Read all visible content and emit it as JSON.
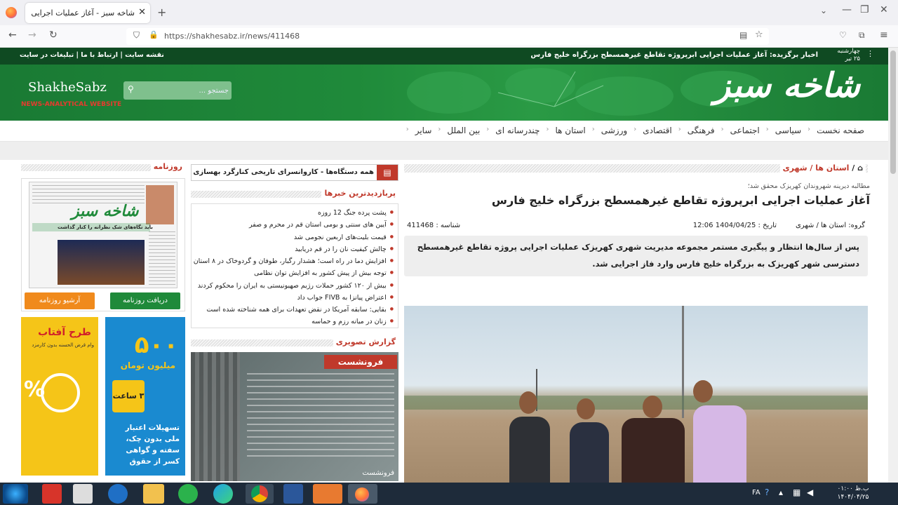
{
  "browser": {
    "tab_title": "شاخه سبز - آغاز عملیات اجرایی ابرپر",
    "url": "https://shakhesabz.ir/news/411468"
  },
  "site": {
    "date_day": "چهارشنبه",
    "date_num": "۲۵ تیر",
    "breaking_label": "اخبار برگزیده:",
    "breaking_text": "آغاز عملیات اجرایی ابرپروژه تقاطع غیرهمسطح بزرگراه خلیج فارس",
    "top_links": [
      "نقشه سایت",
      "ارتباط با ما",
      "تبلیغات در سایت"
    ],
    "logo_fa": "شاخه سبز",
    "logo_en": "ShakheSabz",
    "logo_sub": "NEWS-ANALYTICAL WEBSITE",
    "search_placeholder": "جستجو ..."
  },
  "menu": [
    "صفحه نخست",
    "سیاسی",
    "اجتماعی",
    "فرهنگی",
    "اقتصادی",
    "ورزشی",
    "استان ها",
    "چندرسانه ای",
    "بین الملل",
    "سایر"
  ],
  "article": {
    "breadcrumb": "استان ها / شهری",
    "supertitle": "مطالبه دیرینه شهروندان کهریزک محقق شد؛",
    "title": "آغاز عملیات اجرایی ابرپروژه تقاطع غیرهمسطح بزرگراه خلیج فارس",
    "group_label": "گروه:",
    "group": "استان ها / شهری",
    "date_label": "تاریخ :",
    "date": "1404/04/25 12:06",
    "id_label": "شناسه :",
    "id": "411468",
    "lead": "پس از سال‌ها انتظار و پیگیری مستمر مجموعه مدیریت شهری کهریزک عملیات اجرایی پروژه تقاطع غیرهمسطح دسترسی شهر کهریزک به بزرگراه خلیج فارس وارد فاز اجرایی شد."
  },
  "ticker": "همه دستگاه‌ها - کاروانسرای تاریخی کنارگرد بهسازی می‌شود -",
  "most_viewed": {
    "title": "پربازدیدترین خبرها",
    "items": [
      "پشت پرده جنگ 12 روزه",
      "آیین های سنتی و بومی استان قم در محرم و صفر",
      "قیمت بلیت‌های اربعین نجومی شد",
      "چالش کیفیت نان را در قم دریابید",
      "افزایش دما در راه است؛ هشدار رگبار، طوفان و گردوخاک در ۸ استان",
      "توجه بیش از پیش کشور به افزایش توان نظامی",
      "بیش از ۱۲۰ کشور حملات رژیم صهیونیستی به ایران را محکوم کردند",
      "اعتراض پیانزا به FIVB جواب داد",
      "بقایی: سابقه آمریکا در نقض تعهدات برای همه شناخته شده است",
      "زنان در میانه رزم و حماسه"
    ]
  },
  "photo_report": {
    "title": "گزارش تصویری",
    "poster_title": "فرونشست",
    "caption": "فرونشست"
  },
  "newspaper": {
    "title": "روزنامه",
    "download": "دریافت روزنامه",
    "archive": "آرشیو روزنامه",
    "paper_logo": "شاخه سبز",
    "paper_headline": "باید نگاه‌های شک نظرانه را کنار گذاشت"
  },
  "ads": {
    "ad1_title": "طرح آفتاب",
    "ad1_sub": "وام قرض الحسنه بدون کارمزد",
    "ad2_big": "۵۰۰",
    "ad2_unit": "میلیون تومان",
    "ad2_mid": "۳ ساعت",
    "ad2_text": "تسهیلات اعتبار ملی بدون چک، سفته و گواهی کسر از حقوق"
  },
  "taskbar": {
    "lang": "FA",
    "time": "۰۱:۰۰ ب.ظ",
    "date": "۱۴۰۴/۰۴/۲۵"
  },
  "colors": {
    "site_green": "#1f8a3a",
    "dark_green": "#0f4a22",
    "accent_red": "#c0392b"
  }
}
